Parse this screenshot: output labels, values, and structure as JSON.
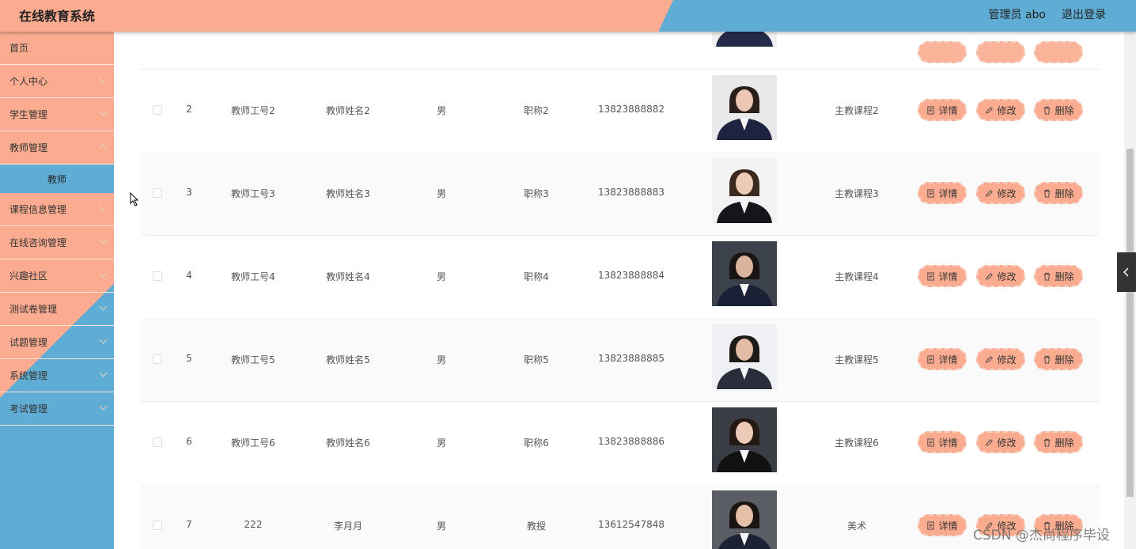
{
  "header": {
    "title": "在线教育系统",
    "user": "管理员 abo",
    "logout": "退出登录"
  },
  "sidebar": {
    "items": [
      {
        "label": "首页",
        "expandable": false
      },
      {
        "label": "个人中心",
        "expandable": true
      },
      {
        "label": "学生管理",
        "expandable": true
      },
      {
        "label": "教师管理",
        "expandable": true,
        "sub": "教师"
      },
      {
        "label": "课程信息管理",
        "expandable": true
      },
      {
        "label": "在线咨询管理",
        "expandable": true
      },
      {
        "label": "兴趣社区",
        "expandable": true
      },
      {
        "label": "测试卷管理",
        "expandable": true
      },
      {
        "label": "试题管理",
        "expandable": true
      },
      {
        "label": "系统管理",
        "expandable": true
      },
      {
        "label": "考试管理",
        "expandable": true
      }
    ]
  },
  "actions": {
    "detail": "详情",
    "edit": "修改",
    "delete": "删除"
  },
  "rows": [
    {
      "index": "2",
      "work_no": "教师工号2",
      "name": "教师姓名2",
      "gender": "男",
      "title": "职称2",
      "phone": "13823888882",
      "course": "主教课程2"
    },
    {
      "index": "3",
      "work_no": "教师工号3",
      "name": "教师姓名3",
      "gender": "男",
      "title": "职称3",
      "phone": "13823888883",
      "course": "主教课程3"
    },
    {
      "index": "4",
      "work_no": "教师工号4",
      "name": "教师姓名4",
      "gender": "男",
      "title": "职称4",
      "phone": "13823888884",
      "course": "主教课程4"
    },
    {
      "index": "5",
      "work_no": "教师工号5",
      "name": "教师姓名5",
      "gender": "男",
      "title": "职称5",
      "phone": "13823888885",
      "course": "主教课程5"
    },
    {
      "index": "6",
      "work_no": "教师工号6",
      "name": "教师姓名6",
      "gender": "男",
      "title": "职称6",
      "phone": "13823888886",
      "course": "主教课程6"
    },
    {
      "index": "7",
      "work_no": "222",
      "name": "李月月",
      "gender": "男",
      "title": "教授",
      "phone": "13612547848",
      "course": "美术"
    }
  ],
  "watermark": "CSDN @杰尚程序毕设",
  "colors": {
    "primary": "#fbab8f",
    "secondary": "#5fadd4"
  }
}
